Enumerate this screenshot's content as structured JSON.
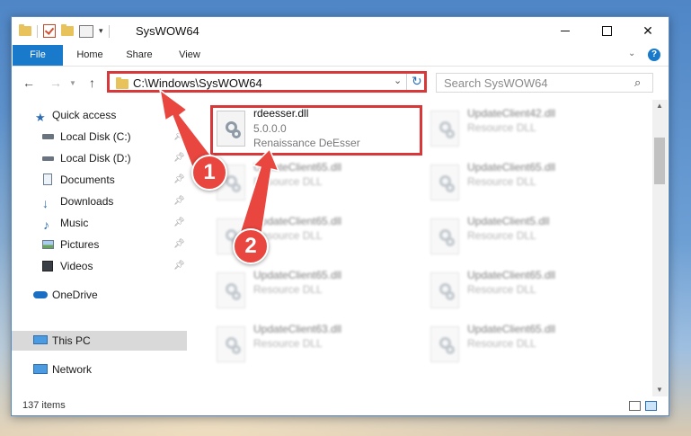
{
  "window": {
    "title": "SysWOW64"
  },
  "ribbon": {
    "tabs": [
      "File",
      "Home",
      "Share",
      "View"
    ],
    "help_label": "?"
  },
  "navigation": {
    "address_path": "C:\\Windows\\SysWOW64",
    "search_placeholder": "Search SysWOW64"
  },
  "sidebar": {
    "items": [
      {
        "label": "Quick access",
        "icon": "star-icon",
        "pinned": false
      },
      {
        "label": "Local Disk (C:)",
        "icon": "drive-icon",
        "pinned": true
      },
      {
        "label": "Local Disk (D:)",
        "icon": "drive-icon",
        "pinned": true
      },
      {
        "label": "Documents",
        "icon": "documents-icon",
        "pinned": true
      },
      {
        "label": "Downloads",
        "icon": "download-icon",
        "pinned": true
      },
      {
        "label": "Music",
        "icon": "music-icon",
        "pinned": true
      },
      {
        "label": "Pictures",
        "icon": "pictures-icon",
        "pinned": true
      },
      {
        "label": "Videos",
        "icon": "videos-icon",
        "pinned": true
      },
      {
        "label": "OneDrive",
        "icon": "cloud-icon",
        "pinned": false
      },
      {
        "label": "This PC",
        "icon": "computer-icon",
        "pinned": false,
        "selected": true
      },
      {
        "label": "Network",
        "icon": "network-icon",
        "pinned": false
      }
    ]
  },
  "files": [
    {
      "name": "rdeesser.dll",
      "version": "5.0.0.0",
      "description": "Renaissance DeEsser",
      "highlighted": true
    },
    {
      "name": "UpdateClient42.dll",
      "description": "Resource DLL"
    },
    {
      "name": "UpdateClient65.dll",
      "description": "Resource DLL"
    },
    {
      "name": "UpdateClient65.dll",
      "description": "Resource DLL"
    },
    {
      "name": "UpdateClient65.dll",
      "description": "Resource DLL"
    },
    {
      "name": "UpdateClient5.dll",
      "description": "Resource DLL"
    },
    {
      "name": "UpdateClient65.dll",
      "description": "Resource DLL"
    },
    {
      "name": "UpdateClient65.dll",
      "description": "Resource DLL"
    },
    {
      "name": "UpdateClient63.dll",
      "description": "Resource DLL"
    },
    {
      "name": "UpdateClient65.dll",
      "description": "Resource DLL"
    }
  ],
  "status": {
    "item_count": "137 items"
  },
  "annotations": {
    "callout_1": "1",
    "callout_2": "2",
    "color": "#e8463f"
  }
}
